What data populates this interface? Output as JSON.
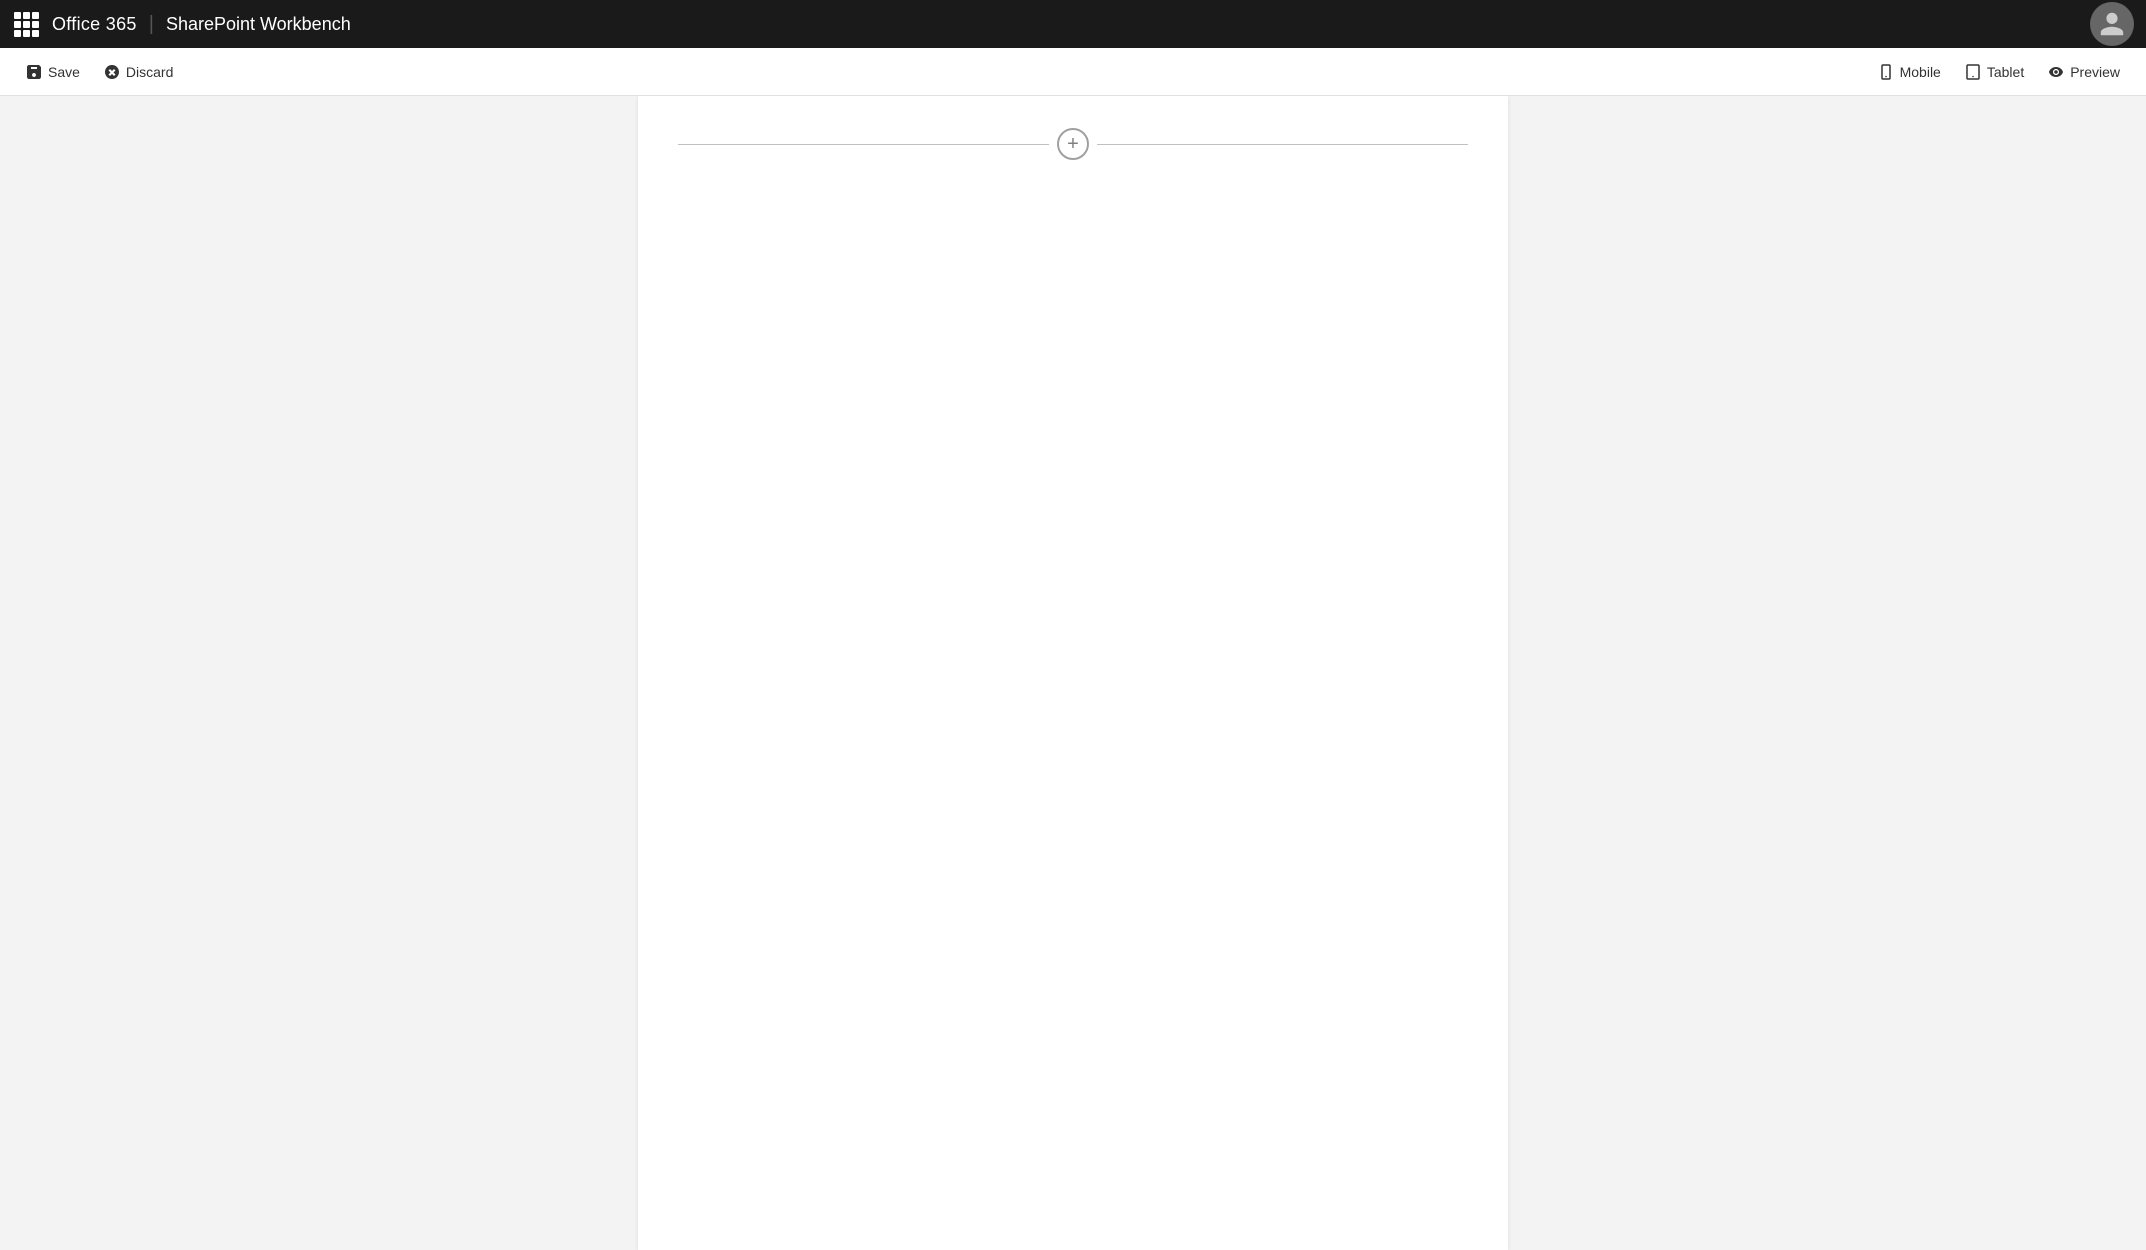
{
  "topNav": {
    "appName": "Office 365",
    "divider": "|",
    "pageName": "SharePoint Workbench"
  },
  "toolbar": {
    "saveLabel": "Save",
    "discardLabel": "Discard",
    "mobileLabel": "Mobile",
    "tabletLabel": "Tablet",
    "previewLabel": "Preview"
  },
  "canvas": {
    "addWebpartLabel": "+"
  },
  "icons": {
    "waffle": "waffle-icon",
    "save": "save-icon",
    "discard": "discard-icon",
    "mobile": "mobile-icon",
    "tablet": "tablet-icon",
    "preview": "preview-icon",
    "user": "user-icon",
    "addWebpart": "add-webpart-icon"
  }
}
